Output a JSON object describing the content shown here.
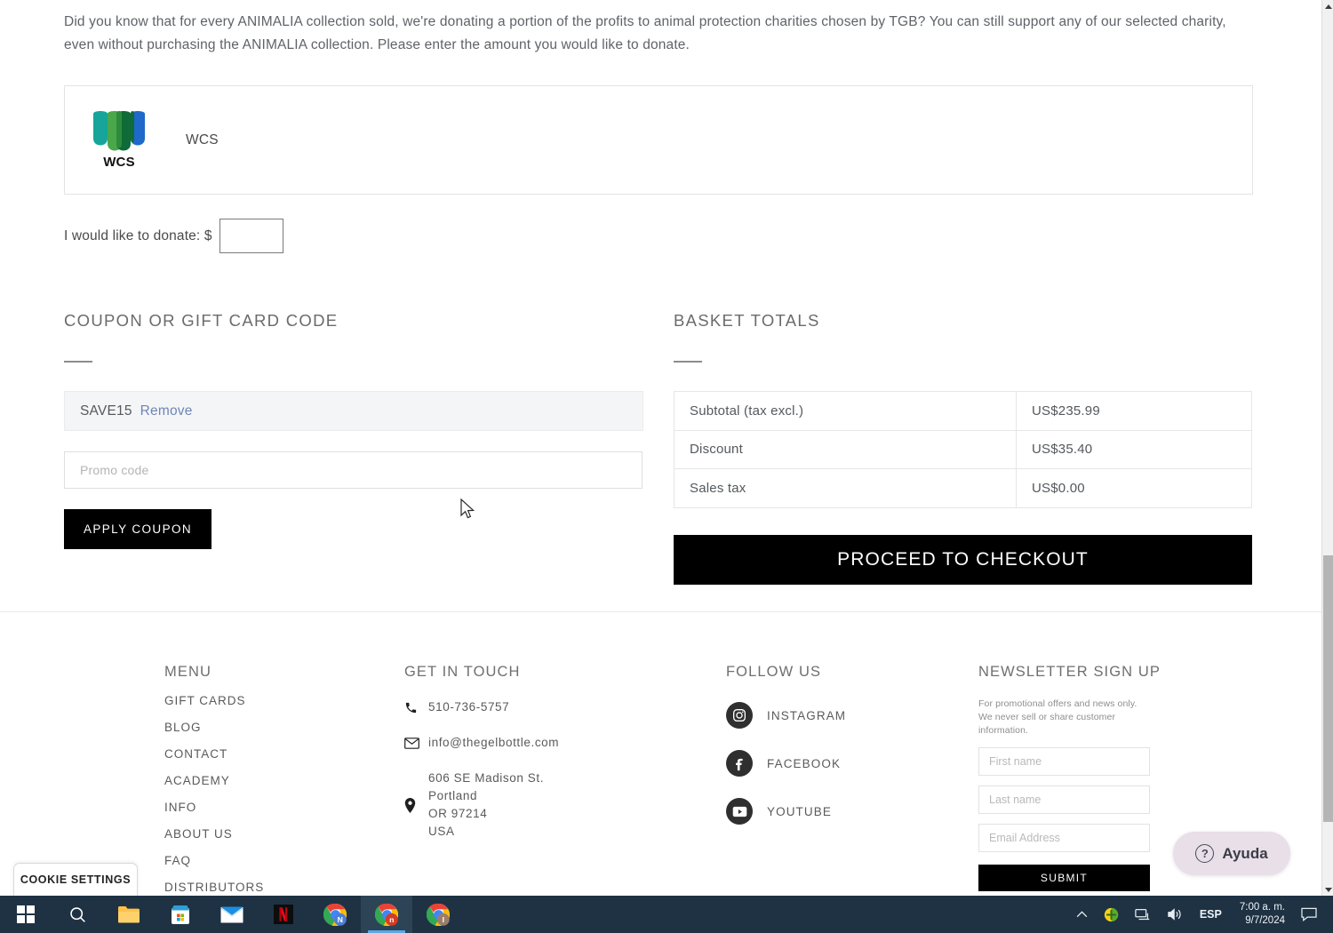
{
  "page": {
    "intro": "Did you know that for every ANIMALIA collection sold, we're donating a portion of the profits to animal protection charities chosen by TGB? You can still support any of our selected charity, even without purchasing the ANIMALIA collection. Please enter the amount you would like to donate."
  },
  "charity": {
    "logo_wordmark": "WCS",
    "name": "WCS"
  },
  "donate": {
    "label": "I would like to donate: $",
    "value": "",
    "placeholder": ""
  },
  "coupon": {
    "title": "COUPON OR GIFT CARD CODE",
    "applied_code": "SAVE15",
    "remove_label": "Remove",
    "promo_value": "",
    "promo_placeholder": "Promo code",
    "apply_label": "APPLY COUPON"
  },
  "basket": {
    "title": "BASKET TOTALS",
    "rows": [
      {
        "label": "Subtotal (tax excl.)",
        "value": "US$235.99"
      },
      {
        "label": "Discount",
        "value": "US$35.40"
      },
      {
        "label": "Sales tax",
        "value": "US$0.00"
      }
    ],
    "checkout_label": "PROCEED TO CHECKOUT"
  },
  "footer": {
    "menu": {
      "heading": "MENU",
      "items": [
        "GIFT CARDS",
        "BLOG",
        "CONTACT",
        "ACADEMY",
        "INFO",
        "ABOUT US",
        "FAQ",
        "DISTRIBUTORS"
      ]
    },
    "touch": {
      "heading": "GET IN TOUCH",
      "phone": "510-736-5757",
      "email": "info@thegelbottle.com",
      "address_line1": "606 SE Madison St.",
      "address_line2": "Portland",
      "address_line3": "OR 97214",
      "address_line4": "USA"
    },
    "follow": {
      "heading": "FOLLOW US",
      "items": [
        {
          "label": "INSTAGRAM",
          "icon": "instagram-icon"
        },
        {
          "label": "FACEBOOK",
          "icon": "facebook-icon"
        },
        {
          "label": "YOUTUBE",
          "icon": "youtube-icon"
        }
      ]
    },
    "newsletter": {
      "heading": "NEWSLETTER SIGN UP",
      "blurb": "For promotional offers and news only. We never sell or share customer information.",
      "first_name_placeholder": "First name",
      "last_name_placeholder": "Last name",
      "email_placeholder": "Email Address",
      "first_name_value": "",
      "last_name_value": "",
      "email_value": "",
      "submit_label": "SUBMIT"
    }
  },
  "cookie": {
    "label": "COOKIE SETTINGS"
  },
  "help": {
    "label": "Ayuda",
    "icon": "question-mark-icon"
  },
  "taskbar": {
    "items": [
      {
        "name": "start-button",
        "icon": "windows-logo-icon"
      },
      {
        "name": "search-button",
        "icon": "search-icon"
      },
      {
        "name": "file-explorer",
        "icon": "folder-icon"
      },
      {
        "name": "microsoft-store",
        "icon": "store-icon"
      },
      {
        "name": "mail-app",
        "icon": "mail-icon"
      },
      {
        "name": "netflix-app",
        "icon": "netflix-icon"
      },
      {
        "name": "chrome-window-1",
        "icon": "chrome-icon"
      },
      {
        "name": "chrome-window-2",
        "icon": "chrome-icon"
      },
      {
        "name": "chrome-window-3",
        "icon": "chrome-icon"
      }
    ],
    "tray": {
      "language": "ESP",
      "time": "7:00 a. m.",
      "date": "9/7/2024"
    }
  },
  "colors": {
    "accent_black": "#000000",
    "link_blue": "#6f85b8",
    "help_bg": "#e8dfe9",
    "taskbar_bg": "#1e3243",
    "wcs_teal": "#17a49a",
    "wcs_green": "#4aa84b",
    "wcs_blue": "#1e69c9",
    "wcs_dark_green": "#0f6b37"
  }
}
